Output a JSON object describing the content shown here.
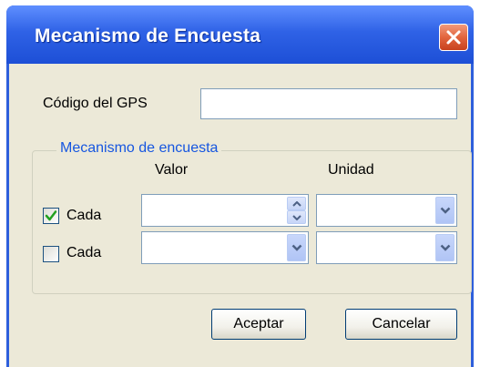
{
  "window": {
    "title": "Mecanismo de Encuesta"
  },
  "form": {
    "gps_label": "Código del GPS",
    "gps_value": ""
  },
  "group": {
    "legend": "Mecanismo de encuesta",
    "col_valor": "Valor",
    "col_unidad": "Unidad",
    "rows": [
      {
        "checkbox_label": "Cada",
        "checked": true,
        "valor_control": "spinner",
        "valor_value": "",
        "unidad_value": ""
      },
      {
        "checkbox_label": "Cada",
        "checked": false,
        "valor_control": "dropdown",
        "valor_value": "",
        "unidad_value": ""
      }
    ]
  },
  "buttons": {
    "accept": "Aceptar",
    "cancel": "Cancelar"
  },
  "icons": {
    "close": "close-icon",
    "check": "checkmark-icon",
    "dropdown": "chevron-down-icon",
    "spin": "spin-up-down-icon"
  },
  "colors": {
    "titlebar": "#2f62e6",
    "dialog_bg": "#ece9d8",
    "legend": "#1656e0",
    "close_button": "#e2643d"
  }
}
